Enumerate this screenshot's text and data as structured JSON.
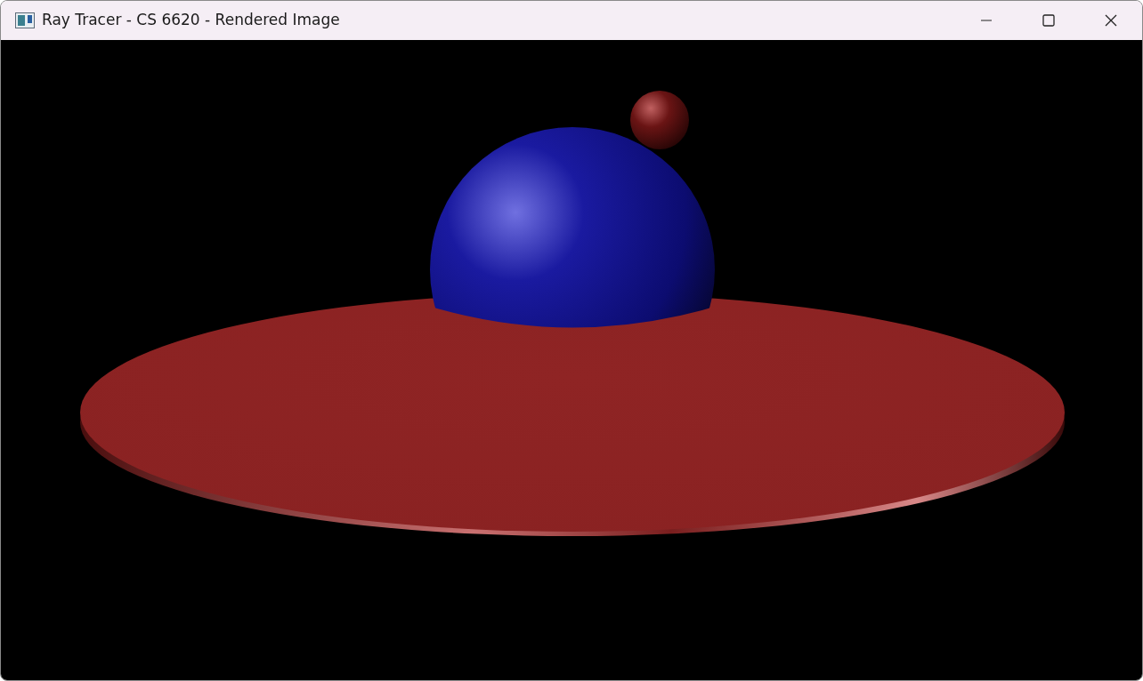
{
  "window": {
    "title": "Ray Tracer - CS 6620 - Rendered Image"
  }
}
